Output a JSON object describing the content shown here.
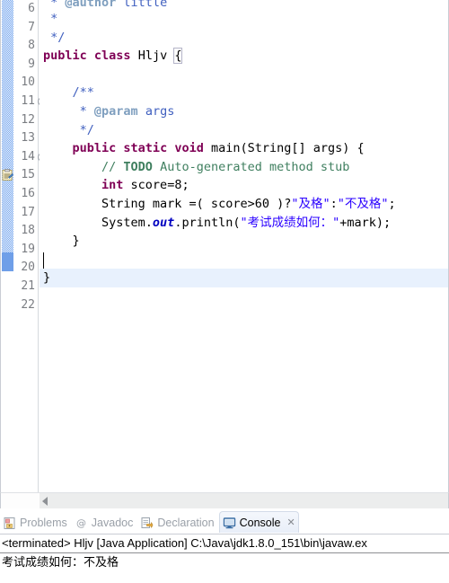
{
  "editor": {
    "first_visible_line": 6,
    "current_line": 21,
    "caret_line": 21,
    "todo_marker_line": 15,
    "fold_marker_lines": [
      11,
      14
    ],
    "colors": {
      "keyword": "#7f0055",
      "comment": "#3f7f5f",
      "javadoc": "#3f5fbf",
      "javadoc_tag": "#7f9fbf",
      "string": "#2a00ff",
      "static_field": "#0000c0",
      "current_line_bg": "#e8f1fd",
      "change_bar": "#7aaaf0"
    },
    "lines": [
      {
        "num": "6",
        "clipped": true,
        "fold": false,
        "todo": false
      },
      {
        "num": "7",
        "fold": false,
        "todo": false
      },
      {
        "num": "8",
        "fold": false,
        "todo": false
      },
      {
        "num": "9",
        "fold": false,
        "todo": false
      },
      {
        "num": "10",
        "fold": false,
        "todo": false
      },
      {
        "num": "11",
        "fold": true,
        "todo": false
      },
      {
        "num": "12",
        "fold": false,
        "todo": false
      },
      {
        "num": "13",
        "fold": false,
        "todo": false
      },
      {
        "num": "14",
        "fold": true,
        "todo": false
      },
      {
        "num": "15",
        "fold": false,
        "todo": true
      },
      {
        "num": "16",
        "fold": false,
        "todo": false
      },
      {
        "num": "17",
        "fold": false,
        "todo": false
      },
      {
        "num": "18",
        "fold": false,
        "todo": false
      },
      {
        "num": "19",
        "fold": false,
        "todo": false
      },
      {
        "num": "20",
        "fold": false,
        "todo": false
      },
      {
        "num": "21",
        "fold": false,
        "todo": false
      },
      {
        "num": "22",
        "fold": false,
        "todo": false
      }
    ],
    "code_text": {
      "l6": " * @author little",
      "l7": " *",
      "l8": " */",
      "l9": "public class Hljv {",
      "l10": "",
      "l11": "    /**",
      "l12": "     * @param args",
      "l13": "     */",
      "l14": "    public static void main(String[] args) {",
      "l15": "        // TODO Auto-generated method stub",
      "l16": "        int score=8;",
      "l17": "        String mark =( score>60 )?\"及格\":\"不及格\";",
      "l18": "        System.out.println(\"考试成绩如何：\"+mark);",
      "l19": "    }",
      "l20": "",
      "l21": "}",
      "l22": ""
    },
    "tokens": {
      "l6_star": " * ",
      "l6_tag": "@author",
      "l6_rest": " little",
      "l7": " *",
      "l8": " */",
      "l9_kw1": "public",
      "l9_sp1": " ",
      "l9_kw2": "class",
      "l9_name": " Hljv ",
      "l9_brace": "{",
      "l11": "    /**",
      "l12_pre": "     * ",
      "l12_tag": "@param",
      "l12_rest": " args",
      "l13": "     */",
      "l14_indent": "    ",
      "l14_kw1": "public",
      "l14_kw2": " static",
      "l14_kw3": " void",
      "l14_rest": " main(String[] args) {",
      "l15_indent": "        ",
      "l15_slashes": "// ",
      "l15_todo": "TODO",
      "l15_rest": " Auto-generated method stub",
      "l16_indent": "        ",
      "l16_kw": "int",
      "l16_rest": " score=8;",
      "l17_pre": "        String mark =( score>60 )?",
      "l17_str1": "\"及格\"",
      "l17_colon": ":",
      "l17_str2": "\"不及格\"",
      "l17_end": ";",
      "l18_pre": "        System.",
      "l18_field": "out",
      "l18_mid": ".println(",
      "l18_str": "\"考试成绩如何：\"",
      "l18_end": "+mark);",
      "l19": "    }",
      "l21": "}"
    },
    "scrollbar": {
      "left_arrow": "scroll-left"
    }
  },
  "bottom_view": {
    "tabs": [
      {
        "id": "problems",
        "label": "Problems",
        "icon": "problems-icon",
        "active": false,
        "closable": false
      },
      {
        "id": "javadoc",
        "label": "Javadoc",
        "icon": "javadoc-icon",
        "active": false,
        "closable": false
      },
      {
        "id": "declaration",
        "label": "Declaration",
        "icon": "declaration-icon",
        "active": false,
        "closable": false
      },
      {
        "id": "console",
        "label": "Console",
        "icon": "console-icon",
        "active": true,
        "closable": true,
        "close_glyph": "✕"
      }
    ],
    "console": {
      "header": "<terminated> Hljv [Java Application] C:\\Java\\jdk1.8.0_151\\bin\\javaw.ex",
      "output": "考试成绩如何：不及格"
    }
  }
}
